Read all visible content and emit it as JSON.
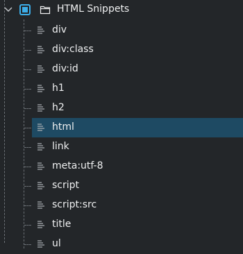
{
  "root": {
    "label": "HTML Snippets",
    "checked": true,
    "expanded": true
  },
  "items": [
    {
      "label": "div"
    },
    {
      "label": "div:class"
    },
    {
      "label": "div:id"
    },
    {
      "label": "h1"
    },
    {
      "label": "h2"
    },
    {
      "label": "html",
      "selected": true
    },
    {
      "label": "link"
    },
    {
      "label": "meta:utf-8"
    },
    {
      "label": "script"
    },
    {
      "label": "script:src"
    },
    {
      "label": "title"
    },
    {
      "label": "ul"
    }
  ],
  "colors": {
    "background": "#232629",
    "selection": "#1e4a63",
    "accent": "#3daee9",
    "text": "#eff0f1"
  }
}
